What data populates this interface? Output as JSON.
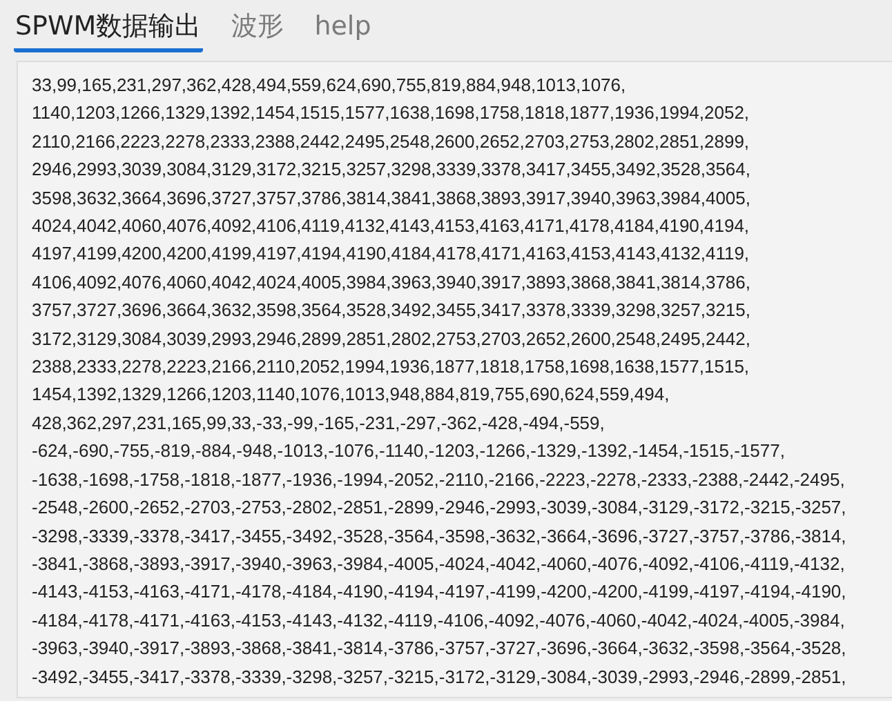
{
  "tabs": [
    {
      "label": "SPWM数据输出",
      "selected": true
    },
    {
      "label": "波形",
      "selected": false
    },
    {
      "label": "help",
      "selected": false
    }
  ],
  "output": {
    "lines": [
      "33,99,165,231,297,362,428,494,559,624,690,755,819,884,948,1013,1076,",
      "1140,1203,1266,1329,1392,1454,1515,1577,1638,1698,1758,1818,1877,1936,1994,2052,",
      "2110,2166,2223,2278,2333,2388,2442,2495,2548,2600,2652,2703,2753,2802,2851,2899,",
      "2946,2993,3039,3084,3129,3172,3215,3257,3298,3339,3378,3417,3455,3492,3528,3564,",
      "3598,3632,3664,3696,3727,3757,3786,3814,3841,3868,3893,3917,3940,3963,3984,4005,",
      "4024,4042,4060,4076,4092,4106,4119,4132,4143,4153,4163,4171,4178,4184,4190,4194,",
      "4197,4199,4200,4200,4199,4197,4194,4190,4184,4178,4171,4163,4153,4143,4132,4119,",
      "4106,4092,4076,4060,4042,4024,4005,3984,3963,3940,3917,3893,3868,3841,3814,3786,",
      "3757,3727,3696,3664,3632,3598,3564,3528,3492,3455,3417,3378,3339,3298,3257,3215,",
      "3172,3129,3084,3039,2993,2946,2899,2851,2802,2753,2703,2652,2600,2548,2495,2442,",
      "2388,2333,2278,2223,2166,2110,2052,1994,1936,1877,1818,1758,1698,1638,1577,1515,",
      "1454,1392,1329,1266,1203,1140,1076,1013,948,884,819,755,690,624,559,494,",
      "428,362,297,231,165,99,33,-33,-99,-165,-231,-297,-362,-428,-494,-559,",
      "-624,-690,-755,-819,-884,-948,-1013,-1076,-1140,-1203,-1266,-1329,-1392,-1454,-1515,-1577,",
      "-1638,-1698,-1758,-1818,-1877,-1936,-1994,-2052,-2110,-2166,-2223,-2278,-2333,-2388,-2442,-2495,",
      "-2548,-2600,-2652,-2703,-2753,-2802,-2851,-2899,-2946,-2993,-3039,-3084,-3129,-3172,-3215,-3257,",
      "-3298,-3339,-3378,-3417,-3455,-3492,-3528,-3564,-3598,-3632,-3664,-3696,-3727,-3757,-3786,-3814,",
      "-3841,-3868,-3893,-3917,-3940,-3963,-3984,-4005,-4024,-4042,-4060,-4076,-4092,-4106,-4119,-4132,",
      "-4143,-4153,-4163,-4171,-4178,-4184,-4190,-4194,-4197,-4199,-4200,-4200,-4199,-4197,-4194,-4190,",
      "-4184,-4178,-4171,-4163,-4153,-4143,-4132,-4119,-4106,-4092,-4076,-4060,-4042,-4024,-4005,-3984,",
      "-3963,-3940,-3917,-3893,-3868,-3841,-3814,-3786,-3757,-3727,-3696,-3664,-3632,-3598,-3564,-3528,",
      "-3492,-3455,-3417,-3378,-3339,-3298,-3257,-3215,-3172,-3129,-3084,-3039,-2993,-2946,-2899,-2851,"
    ]
  }
}
